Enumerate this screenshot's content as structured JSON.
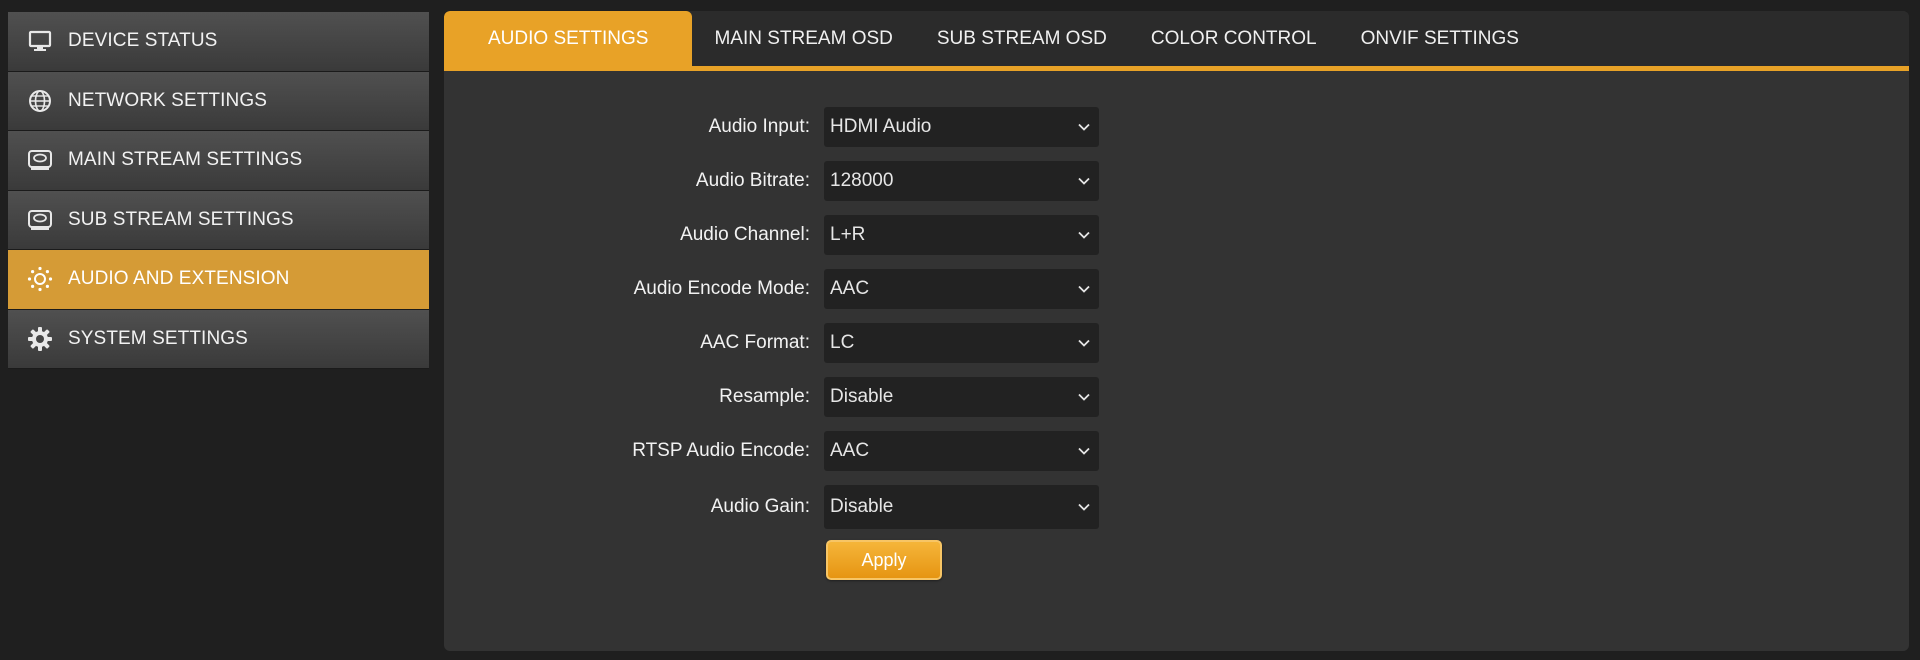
{
  "sidebar": {
    "items": [
      {
        "label": "DEVICE STATUS",
        "icon": "monitor-icon",
        "active": false
      },
      {
        "label": "NETWORK SETTINGS",
        "icon": "globe-icon",
        "active": false
      },
      {
        "label": "MAIN STREAM SETTINGS",
        "icon": "disk-icon",
        "active": false
      },
      {
        "label": "SUB STREAM SETTINGS",
        "icon": "disk-icon",
        "active": false
      },
      {
        "label": "AUDIO AND EXTENSION",
        "icon": "dotted-gear-icon",
        "active": true
      },
      {
        "label": "SYSTEM SETTINGS",
        "icon": "gear-icon",
        "active": false
      }
    ]
  },
  "tabs": [
    {
      "label": "AUDIO SETTINGS",
      "active": true
    },
    {
      "label": "MAIN STREAM OSD",
      "active": false
    },
    {
      "label": "SUB STREAM OSD",
      "active": false
    },
    {
      "label": "COLOR CONTROL",
      "active": false
    },
    {
      "label": "ONVIF SETTINGS",
      "active": false
    }
  ],
  "form": {
    "fields": [
      {
        "label": "Audio Input:",
        "value": "HDMI Audio"
      },
      {
        "label": "Audio Bitrate:",
        "value": "128000"
      },
      {
        "label": "Audio Channel:",
        "value": "L+R"
      },
      {
        "label": "Audio Encode Mode:",
        "value": "AAC"
      },
      {
        "label": "AAC Format:",
        "value": "LC"
      },
      {
        "label": "Resample:",
        "value": "Disable"
      },
      {
        "label": "RTSP Audio Encode:",
        "value": "AAC"
      },
      {
        "label": "Audio Gain:",
        "value": "Disable"
      }
    ],
    "apply_label": "Apply"
  },
  "colors": {
    "accent": "#e8a227",
    "sidebar_active": "#d59b36",
    "panel": "#333333",
    "background": "#1f1f1f"
  }
}
